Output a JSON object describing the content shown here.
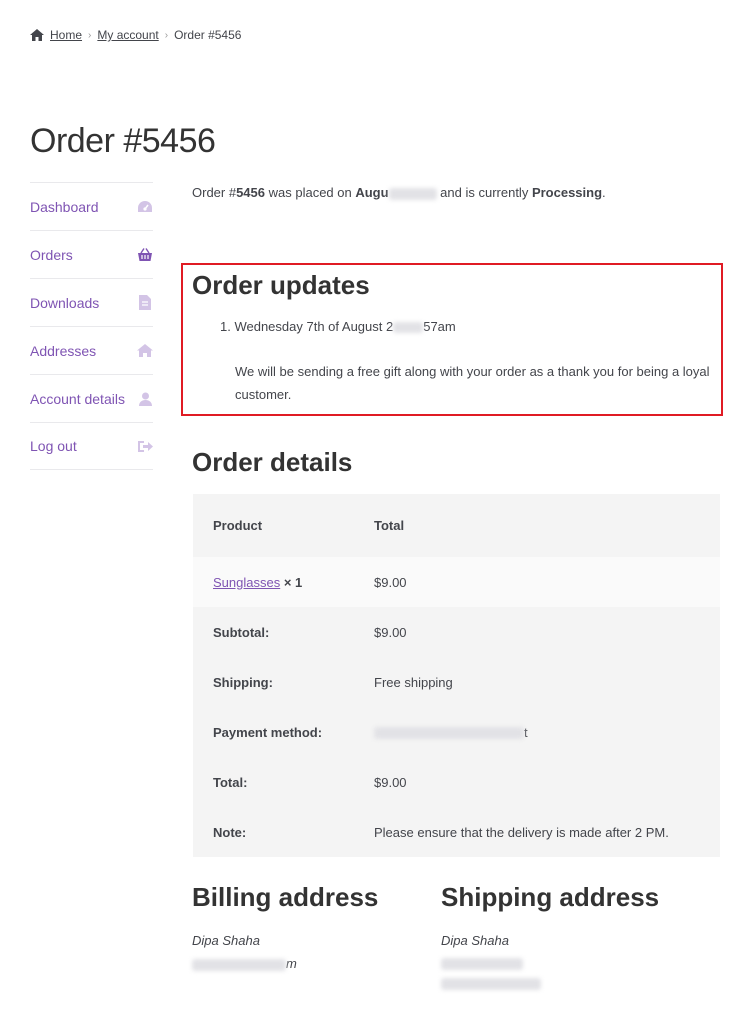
{
  "breadcrumb": {
    "home": "Home",
    "account": "My account",
    "current": "Order #5456",
    "separator": "›"
  },
  "page_title": "Order #5456",
  "sidebar": {
    "items": [
      {
        "label": "Dashboard",
        "icon": "dashboard-gauge-icon"
      },
      {
        "label": "Orders",
        "icon": "basket-icon"
      },
      {
        "label": "Downloads",
        "icon": "file-icon"
      },
      {
        "label": "Addresses",
        "icon": "home-icon"
      },
      {
        "label": "Account details",
        "icon": "user-icon"
      },
      {
        "label": "Log out",
        "icon": "sign-out-icon"
      }
    ]
  },
  "intro": {
    "prefix": "Order #",
    "order_number": "5456",
    "placed_on": " was placed on ",
    "date_visible": "Augu",
    "currently": " and is currently ",
    "status": "Processing",
    "period": "."
  },
  "order_updates": {
    "title": "Order updates",
    "date_prefix": "1. Wednesday 7th of August 2",
    "date_suffix": "57am",
    "note": "We will be sending a free gift along with your order as a thank you for being a loyal customer."
  },
  "order_details": {
    "title": "Order details",
    "headers": [
      "Product",
      "Total"
    ],
    "item": {
      "name": "Sunglasses",
      "qty": "× 1",
      "total": "$9.00"
    },
    "totals": [
      {
        "label": "Subtotal:",
        "value": "$9.00"
      },
      {
        "label": "Shipping:",
        "value": "Free shipping"
      },
      {
        "label": "Payment method:",
        "value": "t"
      },
      {
        "label": "Total:",
        "value": "$9.00"
      },
      {
        "label": "Note:",
        "value": "Please ensure that the delivery is made after 2 PM."
      }
    ]
  },
  "billing": {
    "title": "Billing address",
    "name": "Dipa Shaha",
    "line_visible": "m"
  },
  "shipping": {
    "title": "Shipping address",
    "name": "Dipa Shaha"
  },
  "colors": {
    "link": "#7f54b3",
    "highlight": "#e01b24",
    "text": "#43454b"
  }
}
